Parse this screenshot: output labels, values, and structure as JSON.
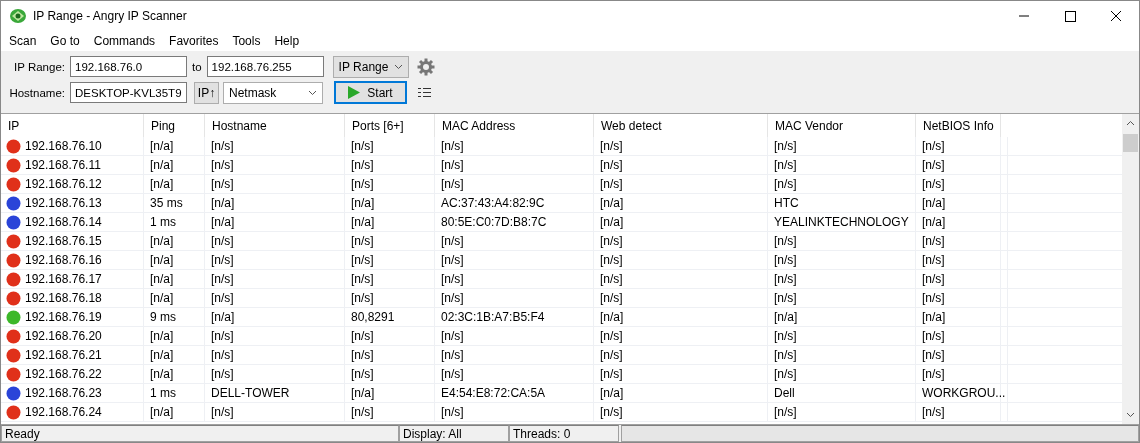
{
  "window": {
    "title": "IP Range - Angry IP Scanner"
  },
  "menu": [
    "Scan",
    "Go to",
    "Commands",
    "Favorites",
    "Tools",
    "Help"
  ],
  "toolbar": {
    "range_label": "IP Range:",
    "start_ip": "192.168.76.0",
    "to_label": "to",
    "end_ip": "192.168.76.255",
    "feeder": "IP Range",
    "hostname_label": "Hostname:",
    "hostname": "DESKTOP-KVL35T9",
    "ip_button": "IP↑",
    "netmask": "Netmask",
    "start_button": "Start"
  },
  "table": {
    "columns": [
      "IP",
      "Ping",
      "Hostname",
      "Ports [6+]",
      "MAC Address",
      "Web detect",
      "MAC Vendor",
      "NetBIOS Info"
    ],
    "rows": [
      {
        "color": "#e0301a",
        "cells": [
          "192.168.76.10",
          "[n/a]",
          "[n/s]",
          "[n/s]",
          "[n/s]",
          "[n/s]",
          "[n/s]",
          "[n/s]"
        ]
      },
      {
        "color": "#e0301a",
        "cells": [
          "192.168.76.11",
          "[n/a]",
          "[n/s]",
          "[n/s]",
          "[n/s]",
          "[n/s]",
          "[n/s]",
          "[n/s]"
        ]
      },
      {
        "color": "#e0301a",
        "cells": [
          "192.168.76.12",
          "[n/a]",
          "[n/s]",
          "[n/s]",
          "[n/s]",
          "[n/s]",
          "[n/s]",
          "[n/s]"
        ]
      },
      {
        "color": "#2a44d8",
        "cells": [
          "192.168.76.13",
          "35 ms",
          "[n/a]",
          "[n/a]",
          "AC:37:43:A4:82:9C",
          "[n/a]",
          "HTC",
          "[n/a]"
        ]
      },
      {
        "color": "#2a44d8",
        "cells": [
          "192.168.76.14",
          "1 ms",
          "[n/a]",
          "[n/a]",
          "80:5E:C0:7D:B8:7C",
          "[n/a]",
          "YEALINKTECHNOLOGY",
          "[n/a]"
        ]
      },
      {
        "color": "#e0301a",
        "cells": [
          "192.168.76.15",
          "[n/a]",
          "[n/s]",
          "[n/s]",
          "[n/s]",
          "[n/s]",
          "[n/s]",
          "[n/s]"
        ]
      },
      {
        "color": "#e0301a",
        "cells": [
          "192.168.76.16",
          "[n/a]",
          "[n/s]",
          "[n/s]",
          "[n/s]",
          "[n/s]",
          "[n/s]",
          "[n/s]"
        ]
      },
      {
        "color": "#e0301a",
        "cells": [
          "192.168.76.17",
          "[n/a]",
          "[n/s]",
          "[n/s]",
          "[n/s]",
          "[n/s]",
          "[n/s]",
          "[n/s]"
        ]
      },
      {
        "color": "#e0301a",
        "cells": [
          "192.168.76.18",
          "[n/a]",
          "[n/s]",
          "[n/s]",
          "[n/s]",
          "[n/s]",
          "[n/s]",
          "[n/s]"
        ]
      },
      {
        "color": "#3cb82a",
        "cells": [
          "192.168.76.19",
          "9 ms",
          "[n/a]",
          "80,8291",
          "02:3C:1B:A7:B5:F4",
          "[n/a]",
          "[n/a]",
          "[n/a]"
        ]
      },
      {
        "color": "#e0301a",
        "cells": [
          "192.168.76.20",
          "[n/a]",
          "[n/s]",
          "[n/s]",
          "[n/s]",
          "[n/s]",
          "[n/s]",
          "[n/s]"
        ]
      },
      {
        "color": "#e0301a",
        "cells": [
          "192.168.76.21",
          "[n/a]",
          "[n/s]",
          "[n/s]",
          "[n/s]",
          "[n/s]",
          "[n/s]",
          "[n/s]"
        ]
      },
      {
        "color": "#e0301a",
        "cells": [
          "192.168.76.22",
          "[n/a]",
          "[n/s]",
          "[n/s]",
          "[n/s]",
          "[n/s]",
          "[n/s]",
          "[n/s]"
        ]
      },
      {
        "color": "#2a44d8",
        "cells": [
          "192.168.76.23",
          "1 ms",
          "DELL-TOWER",
          "[n/a]",
          "E4:54:E8:72:CA:5A",
          "[n/a]",
          "Dell",
          "WORKGROU..."
        ]
      },
      {
        "color": "#e0301a",
        "cells": [
          "192.168.76.24",
          "[n/a]",
          "[n/s]",
          "[n/s]",
          "[n/s]",
          "[n/s]",
          "[n/s]",
          "[n/s]"
        ]
      }
    ]
  },
  "status_bar": [
    "Ready",
    "Display: All",
    "Threads: 0"
  ]
}
